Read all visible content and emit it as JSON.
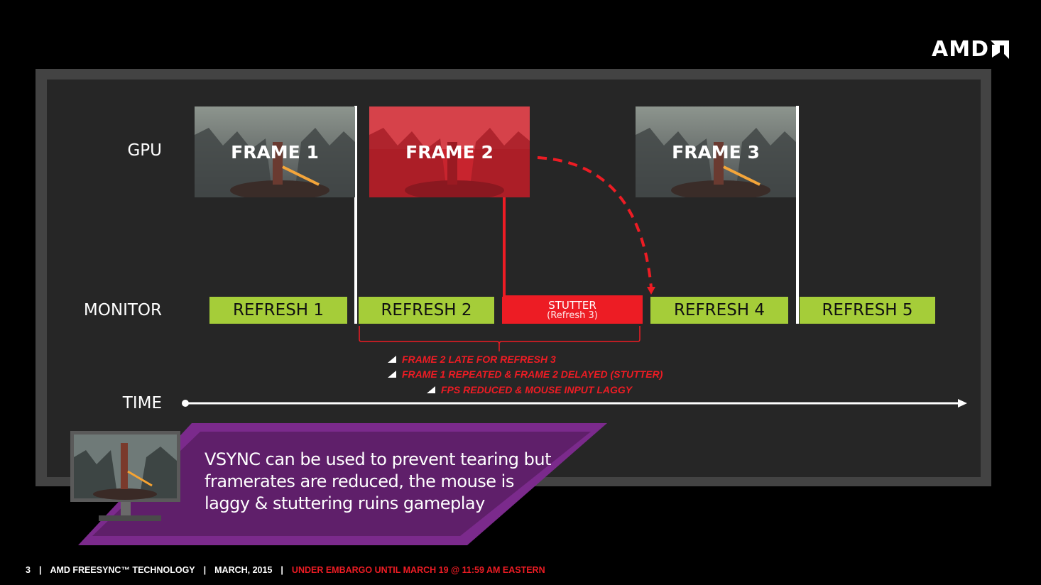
{
  "brand": {
    "logo_text": "AMD"
  },
  "diagram": {
    "row_labels": {
      "gpu": "GPU",
      "monitor": "MONITOR",
      "time": "TIME"
    },
    "gpu_frames": [
      {
        "label": "FRAME 1",
        "state": "normal"
      },
      {
        "label": "FRAME 2",
        "state": "late"
      },
      {
        "label": "FRAME 3",
        "state": "normal"
      }
    ],
    "monitor_refreshes": [
      {
        "label": "REFRESH 1",
        "state": "ok"
      },
      {
        "label": "REFRESH 2",
        "state": "ok"
      },
      {
        "label": "STUTTER",
        "sublabel": "(Refresh 3)",
        "state": "stutter"
      },
      {
        "label": "REFRESH 4",
        "state": "ok"
      },
      {
        "label": "REFRESH 5",
        "state": "ok"
      }
    ],
    "notes": [
      "FRAME 2 LATE FOR REFRESH 3",
      "FRAME 1 REPEATED & FRAME 2 DELAYED (STUTTER)",
      "FPS REDUCED & MOUSE INPUT  LAGGY"
    ],
    "colors": {
      "refresh_ok": "#a5cd39",
      "stutter": "#ed1c24",
      "callout": "#5f1f6a",
      "callout_border": "#7b2a8c",
      "panel": "#262626",
      "frame_border": "#434343"
    }
  },
  "callout": {
    "lines": [
      "VSYNC can be used to prevent tearing but",
      "framerates are reduced, the mouse is",
      "laggy & stuttering ruins gameplay"
    ]
  },
  "footer": {
    "page_number": "3",
    "title": "AMD FREESYNC™ TECHNOLOGY",
    "date": "MARCH, 2015",
    "embargo": "UNDER EMBARGO UNTIL MARCH 19 @ 11:59 AM EASTERN"
  }
}
